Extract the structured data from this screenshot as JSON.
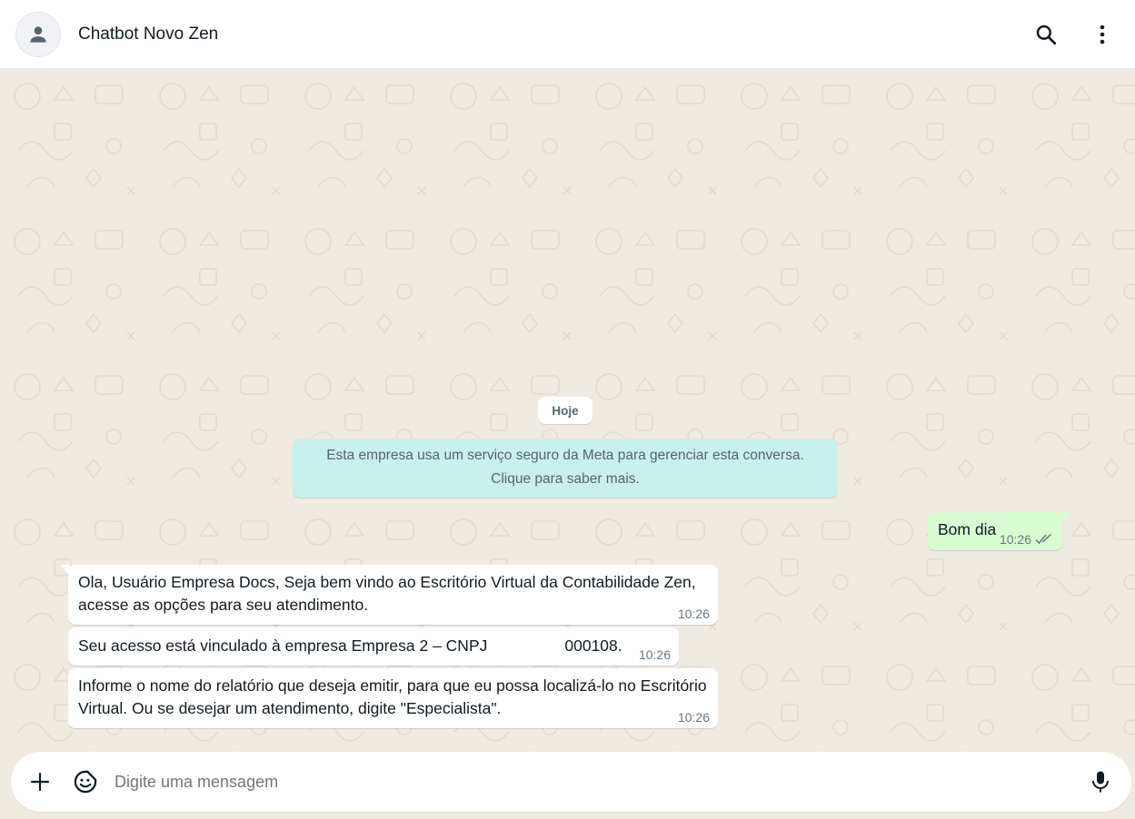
{
  "header": {
    "contact_name": "Chatbot Novo Zen",
    "icons": [
      "person-icon",
      "search-icon",
      "more-vertical-icon"
    ]
  },
  "chat": {
    "date_label": "Hoje",
    "system_notice": {
      "line1": "Esta empresa usa um serviço seguro da Meta para gerenciar esta conversa.",
      "line2": "Clique para saber mais."
    },
    "messages": [
      {
        "direction": "outgoing",
        "text": "Bom dia",
        "time": "10:26",
        "status": "read"
      },
      {
        "direction": "incoming",
        "text": "Ola, Usuário Empresa Docs, Seja bem vindo ao Escritório Virtual da Contabilidade Zen, acesse as opções para seu atendimento.",
        "time": "10:26"
      },
      {
        "direction": "incoming",
        "text_prefix": "Seu acesso está vinculado à empresa Empresa 2  – CNPJ",
        "text_suffix": "000108.",
        "time": "10:26"
      },
      {
        "direction": "incoming",
        "text": "Informe o nome do relatório que deseja emitir, para que eu possa localizá-lo no Escritório Virtual. Ou se desejar um atendimento, digite \"Especialista\".",
        "time": "10:26"
      }
    ]
  },
  "composer": {
    "placeholder": "Digite uma mensagem",
    "icons": [
      "plus-icon",
      "sticker-icon",
      "microphone-icon"
    ]
  },
  "colors": {
    "chat_background": "#efeae2",
    "outgoing_bubble": "#d9fdd3",
    "incoming_bubble": "#ffffff",
    "system_notice": "#c9f1ec",
    "read_ticks": "#667781"
  }
}
